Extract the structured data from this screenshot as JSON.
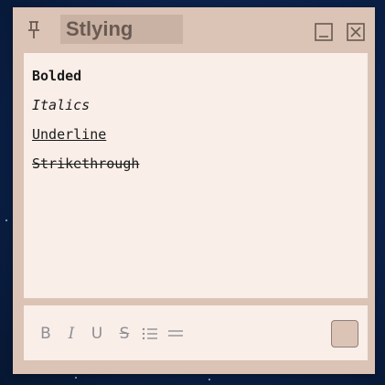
{
  "note": {
    "title": "Stlying",
    "lines": {
      "bold": "Bolded",
      "italic": "Italics",
      "underline": "Underline",
      "strike": "Strikethrough"
    },
    "toolbar": {
      "bold": "B",
      "italic": "I",
      "underline": "U",
      "strike": "S"
    }
  },
  "colors": {
    "frame": "#dbc4b5",
    "paper": "#f9eee8",
    "icon": "#8f8f94",
    "background": "#0a1f45"
  },
  "icons": [
    "pin-icon",
    "minimize-icon",
    "close-icon",
    "bullet-list-icon",
    "paragraph-icon"
  ]
}
